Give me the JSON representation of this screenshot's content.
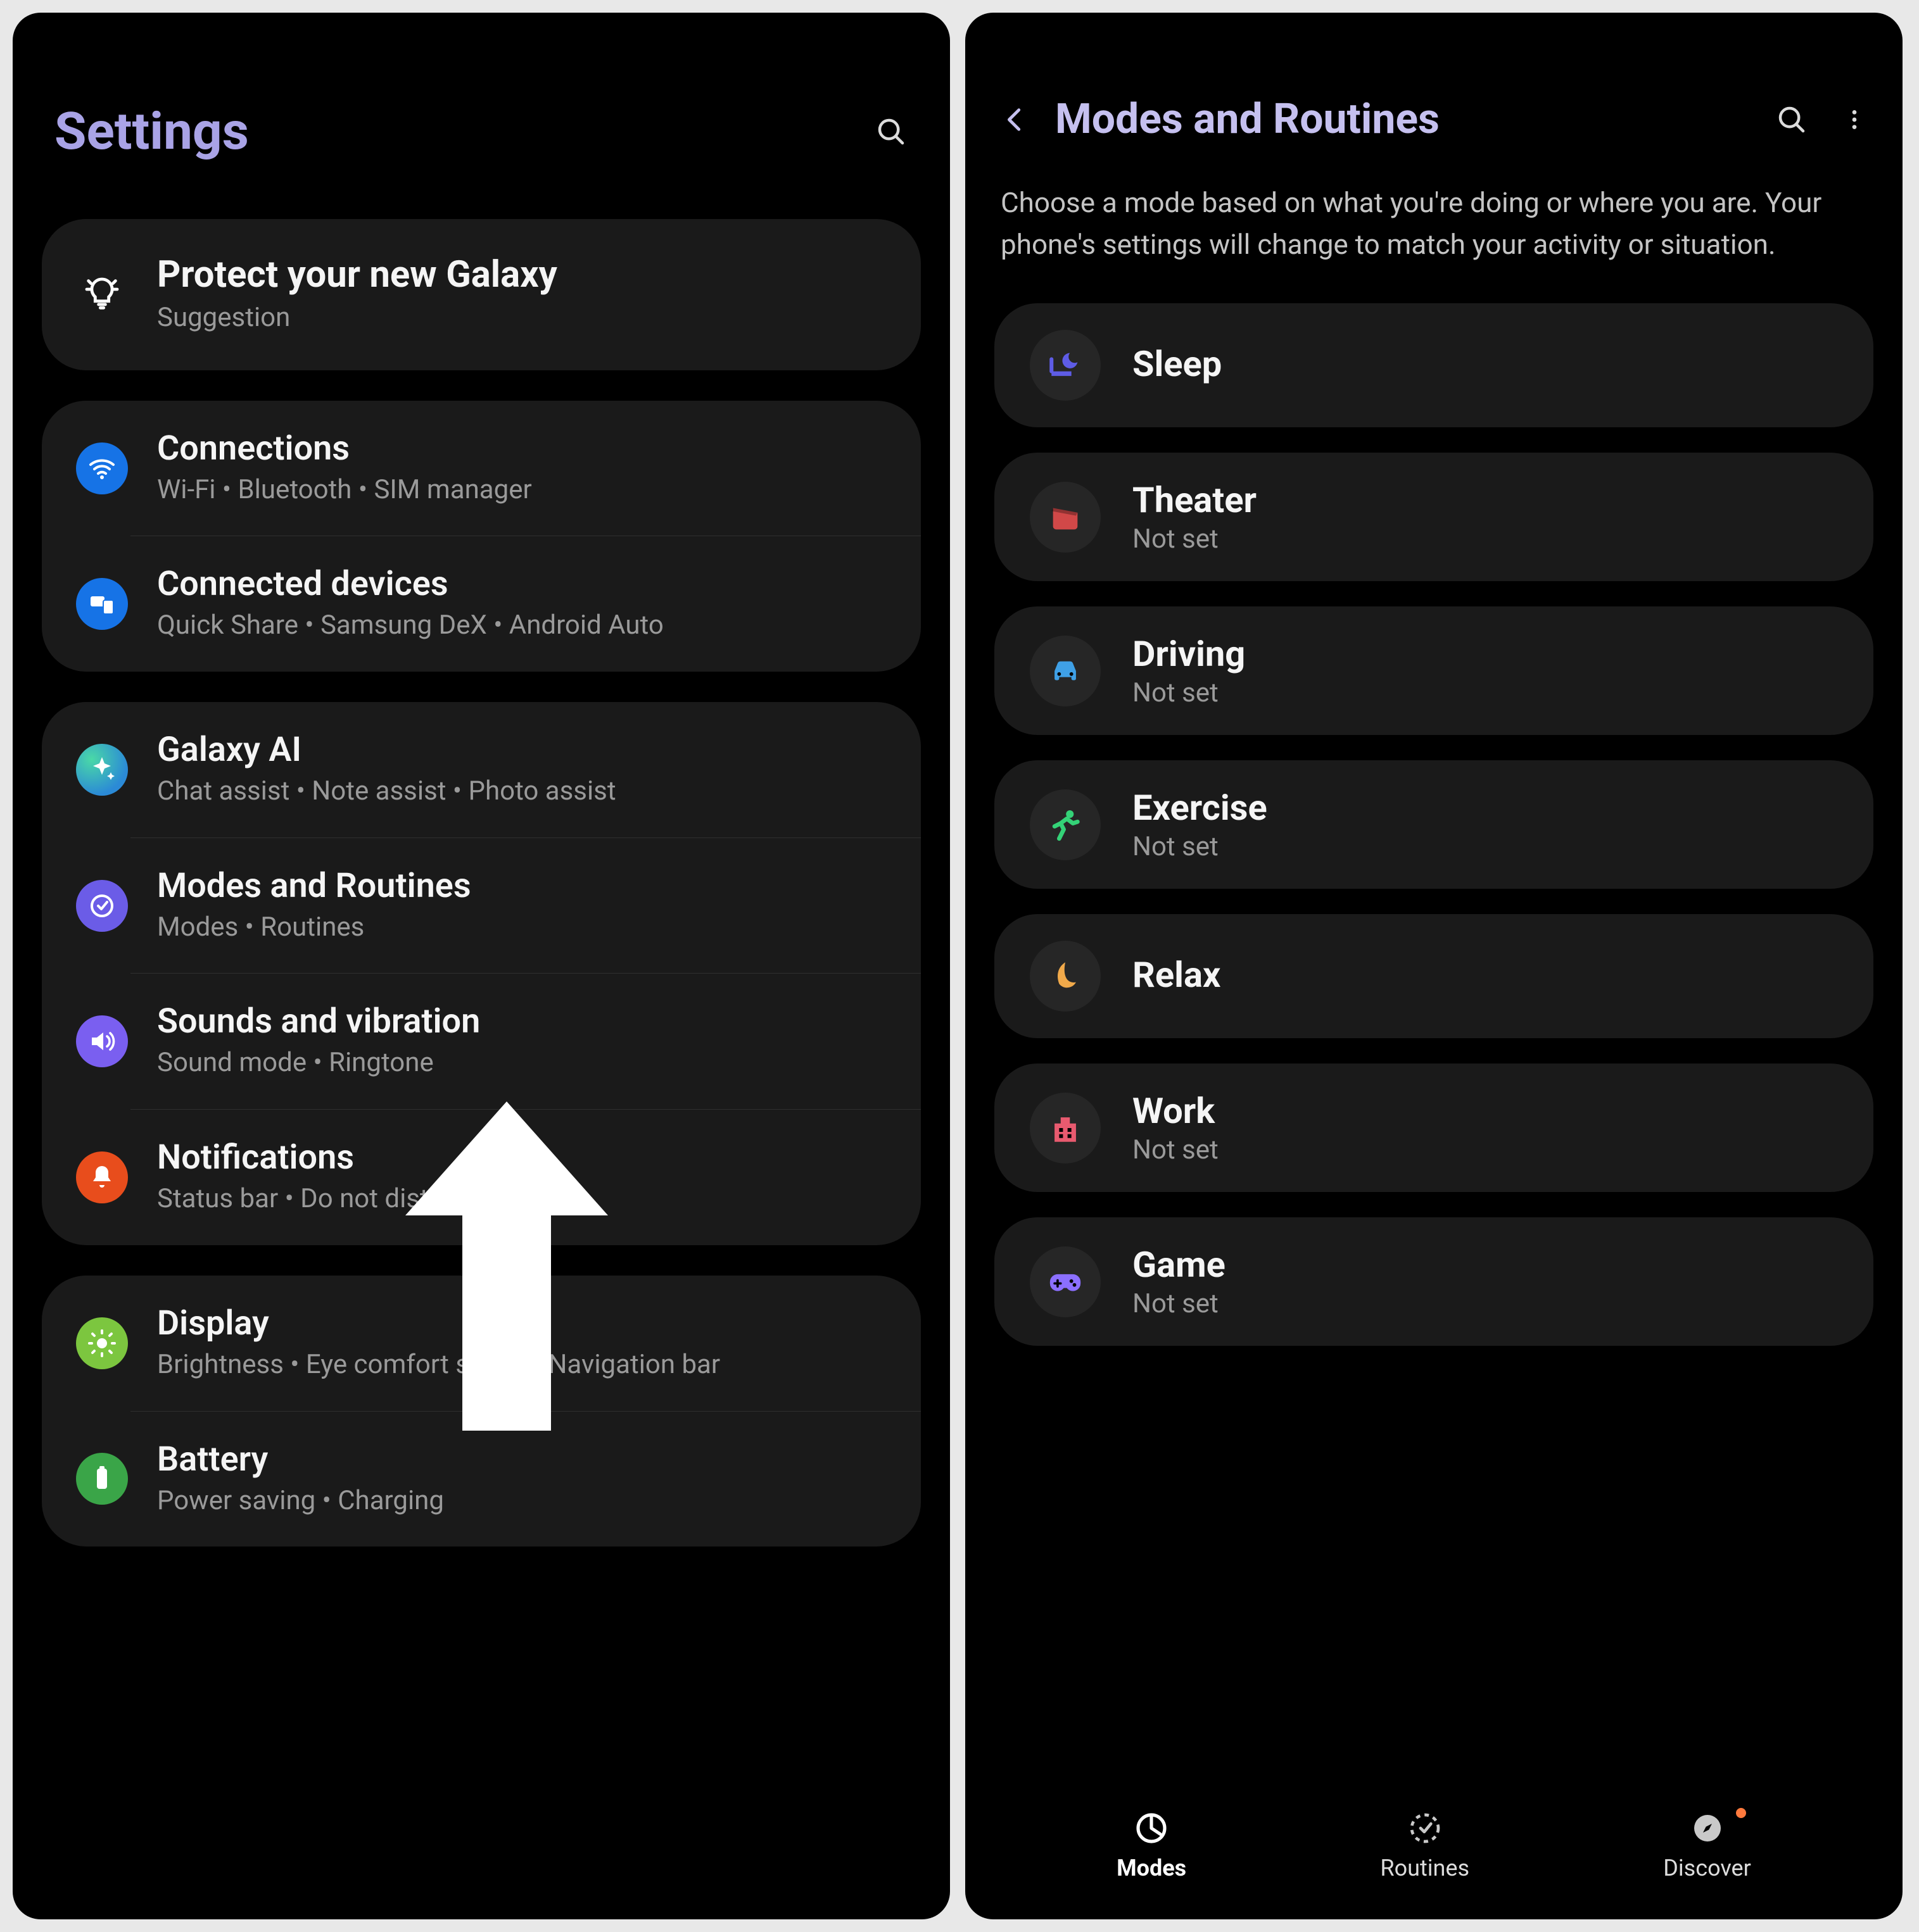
{
  "settings": {
    "title": "Settings",
    "suggestion": {
      "title": "Protect your new Galaxy",
      "subtitle": "Suggestion"
    },
    "groups": [
      {
        "items": [
          {
            "icon": "wifi",
            "bg": "bg-blue",
            "title": "Connections",
            "sub": "Wi-Fi  •  Bluetooth  •  SIM manager"
          },
          {
            "icon": "devices",
            "bg": "bg-blue",
            "title": "Connected devices",
            "sub": "Quick Share  •  Samsung DeX  •  Android Auto"
          }
        ]
      },
      {
        "items": [
          {
            "icon": "sparkle",
            "bg": "bg-teal",
            "title": "Galaxy AI",
            "sub": "Chat assist  •  Note assist  •  Photo assist"
          },
          {
            "icon": "routines",
            "bg": "bg-purple",
            "title": "Modes and Routines",
            "sub": "Modes  •  Routines"
          },
          {
            "icon": "sound",
            "bg": "bg-violet",
            "title": "Sounds and vibration",
            "sub": "Sound mode  •  Ringtone"
          },
          {
            "icon": "bell",
            "bg": "bg-deeporange",
            "title": "Notifications",
            "sub": "Status bar  •  Do not disturb"
          }
        ]
      },
      {
        "items": [
          {
            "icon": "display",
            "bg": "bg-lime",
            "title": "Display",
            "sub": "Brightness  •  Eye comfort shield  •  Navigation bar"
          },
          {
            "icon": "battery",
            "bg": "bg-green2",
            "title": "Battery",
            "sub": "Power saving  •  Charging"
          }
        ]
      }
    ]
  },
  "modes": {
    "title": "Modes and Routines",
    "description": "Choose a mode based on what you're doing or where you are. Your phone's settings will change to match your activity or situation.",
    "not_set": "Not set",
    "items": [
      {
        "icon": "sleep",
        "iconClass": "ic-sleep",
        "title": "Sleep",
        "sub": ""
      },
      {
        "icon": "theater",
        "iconClass": "ic-theater",
        "title": "Theater",
        "sub": "Not set"
      },
      {
        "icon": "driving",
        "iconClass": "ic-driving",
        "title": "Driving",
        "sub": "Not set"
      },
      {
        "icon": "exercise",
        "iconClass": "ic-exercise",
        "title": "Exercise",
        "sub": "Not set"
      },
      {
        "icon": "relax",
        "iconClass": "ic-relax",
        "title": "Relax",
        "sub": ""
      },
      {
        "icon": "work",
        "iconClass": "ic-work",
        "title": "Work",
        "sub": "Not set"
      },
      {
        "icon": "game",
        "iconClass": "ic-game",
        "title": "Game",
        "sub": "Not set"
      }
    ],
    "nav": {
      "modes": "Modes",
      "routines": "Routines",
      "discover": "Discover"
    }
  }
}
